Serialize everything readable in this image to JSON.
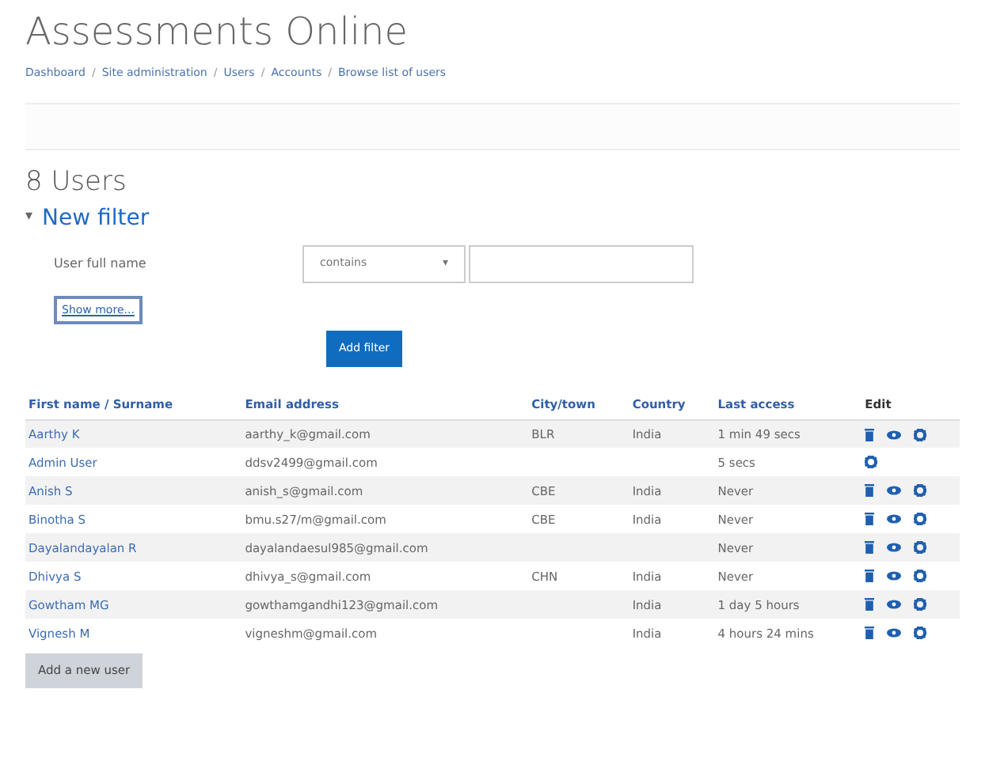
{
  "site_title": "Assessments Online",
  "breadcrumb": {
    "separator": "/",
    "items": [
      "Dashboard",
      "Site administration",
      "Users",
      "Accounts",
      "Browse list of users"
    ]
  },
  "heading": "8 Users",
  "filter": {
    "toggle": "▾",
    "title": "New filter",
    "expanded": true,
    "field_label": "User full name",
    "operator": "contains",
    "operator_caret": "▾",
    "show_more": "Show more...",
    "add_button": "Add filter"
  },
  "table": {
    "columns": [
      "First name / Surname",
      "Email address",
      "City/town",
      "Country",
      "Last access",
      "Edit"
    ],
    "rows": [
      {
        "name": "Aarthy K",
        "email": "aarthy_k@gmail.com",
        "city": "BLR",
        "country": "India",
        "last_access": "1 min 49 secs",
        "actions": [
          {
            "kind": "delete"
          },
          {
            "kind": "view"
          },
          {
            "kind": "settings"
          }
        ]
      },
      {
        "name": "Admin User",
        "email": "ddsv2499@gmail.com",
        "last_access": "5 secs",
        "actions": [
          {
            "kind": "settings"
          }
        ]
      },
      {
        "name": "Anish S",
        "email": "anish_s@gmail.com",
        "city": "CBE",
        "country": "India",
        "last_access": "Never",
        "actions": [
          {
            "kind": "delete"
          },
          {
            "kind": "view"
          },
          {
            "kind": "settings"
          }
        ]
      },
      {
        "name": "Binotha S",
        "email": "bmu.s27/m@gmail.com",
        "city": "CBE",
        "country": "India",
        "last_access": "Never",
        "actions": [
          {
            "kind": "delete"
          },
          {
            "kind": "view"
          },
          {
            "kind": "settings"
          }
        ]
      },
      {
        "name": "Dayalandayalan R",
        "email": "dayalandaesul985@gmail.com",
        "last_access": "Never",
        "actions": [
          {
            "kind": "delete"
          },
          {
            "kind": "view"
          },
          {
            "kind": "settings"
          }
        ]
      },
      {
        "name": "Dhivya S",
        "email": "dhivya_s@gmail.com",
        "city": "CHN",
        "country": "India",
        "last_access": "Never",
        "actions": [
          {
            "kind": "delete"
          },
          {
            "kind": "view"
          },
          {
            "kind": "settings"
          }
        ]
      },
      {
        "name": "Gowtham MG",
        "email": "gowthamgandhi123@gmail.com",
        "country": "India",
        "last_access": "1 day 5 hours",
        "actions": [
          {
            "kind": "delete"
          },
          {
            "kind": "view"
          },
          {
            "kind": "settings"
          }
        ]
      },
      {
        "name": "Vignesh M",
        "email": "vigneshm@gmail.com",
        "country": "India",
        "last_access": "4 hours 24 mins",
        "actions": [
          {
            "kind": "delete"
          },
          {
            "kind": "view"
          },
          {
            "kind": "settings"
          }
        ]
      }
    ]
  },
  "add_user_button": "Add a new user"
}
